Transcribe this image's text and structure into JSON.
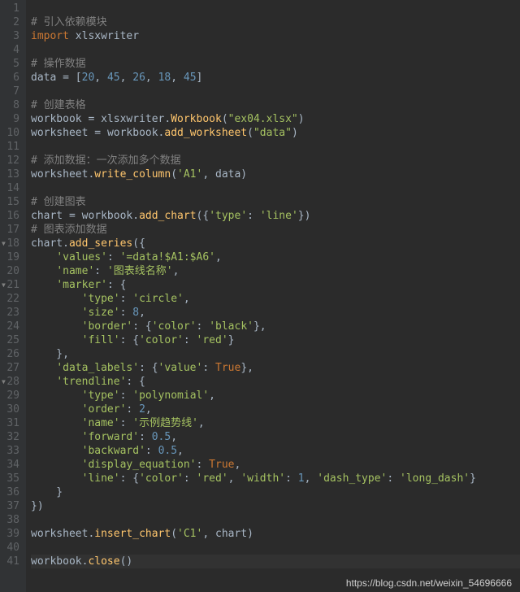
{
  "watermark": "https://blog.csdn.net/weixin_54696666",
  "gutter": {
    "start": 1,
    "end": 41,
    "fold_lines": [
      18,
      21,
      28
    ]
  },
  "code": {
    "1": [],
    "2": [
      {
        "t": "# 引入依赖模块",
        "c": "comment"
      }
    ],
    "3": [
      {
        "t": "import ",
        "c": "keyword"
      },
      {
        "t": "xlsxwriter",
        "c": "module"
      }
    ],
    "4": [],
    "5": [
      {
        "t": "# 操作数据",
        "c": "comment"
      }
    ],
    "6": [
      {
        "t": "data ",
        "c": "op"
      },
      {
        "t": "= ",
        "c": "op"
      },
      {
        "t": "[",
        "c": "paren"
      },
      {
        "t": "20",
        "c": "number"
      },
      {
        "t": ", ",
        "c": "op"
      },
      {
        "t": "45",
        "c": "number"
      },
      {
        "t": ", ",
        "c": "op"
      },
      {
        "t": "26",
        "c": "number"
      },
      {
        "t": ", ",
        "c": "op"
      },
      {
        "t": "18",
        "c": "number"
      },
      {
        "t": ", ",
        "c": "op"
      },
      {
        "t": "45",
        "c": "number"
      },
      {
        "t": "]",
        "c": "paren"
      }
    ],
    "7": [],
    "8": [
      {
        "t": "# 创建表格",
        "c": "comment"
      }
    ],
    "9": [
      {
        "t": "workbook ",
        "c": "op"
      },
      {
        "t": "= ",
        "c": "op"
      },
      {
        "t": "xlsxwriter.",
        "c": "module"
      },
      {
        "t": "Workbook",
        "c": "func"
      },
      {
        "t": "(",
        "c": "paren"
      },
      {
        "t": "\"ex04.xlsx\"",
        "c": "string"
      },
      {
        "t": ")",
        "c": "paren"
      }
    ],
    "10": [
      {
        "t": "worksheet ",
        "c": "op"
      },
      {
        "t": "= ",
        "c": "op"
      },
      {
        "t": "workbook.",
        "c": "module"
      },
      {
        "t": "add_worksheet",
        "c": "func"
      },
      {
        "t": "(",
        "c": "paren"
      },
      {
        "t": "\"data\"",
        "c": "string"
      },
      {
        "t": ")",
        "c": "paren"
      }
    ],
    "11": [],
    "12": [
      {
        "t": "# 添加数据：一次添加多个数据",
        "c": "comment"
      }
    ],
    "13": [
      {
        "t": "worksheet.",
        "c": "module"
      },
      {
        "t": "write_column",
        "c": "func"
      },
      {
        "t": "(",
        "c": "paren"
      },
      {
        "t": "'A1'",
        "c": "string"
      },
      {
        "t": ", data)",
        "c": "paren"
      }
    ],
    "14": [],
    "15": [
      {
        "t": "# 创建图表",
        "c": "comment"
      }
    ],
    "16": [
      {
        "t": "chart ",
        "c": "op"
      },
      {
        "t": "= ",
        "c": "op"
      },
      {
        "t": "workbook.",
        "c": "module"
      },
      {
        "t": "add_chart",
        "c": "func"
      },
      {
        "t": "({",
        "c": "paren"
      },
      {
        "t": "'type'",
        "c": "string"
      },
      {
        "t": ": ",
        "c": "op"
      },
      {
        "t": "'line'",
        "c": "string"
      },
      {
        "t": "})",
        "c": "paren"
      }
    ],
    "17": [
      {
        "t": "# 图表添加数据",
        "c": "comment"
      }
    ],
    "18": [
      {
        "t": "chart.",
        "c": "module"
      },
      {
        "t": "add_series",
        "c": "func"
      },
      {
        "t": "({",
        "c": "paren"
      }
    ],
    "19": [
      {
        "t": "    ",
        "c": "op"
      },
      {
        "t": "'values'",
        "c": "string"
      },
      {
        "t": ": ",
        "c": "op"
      },
      {
        "t": "'=data!$A1:$A6'",
        "c": "string"
      },
      {
        "t": ",",
        "c": "op"
      }
    ],
    "20": [
      {
        "t": "    ",
        "c": "op"
      },
      {
        "t": "'name'",
        "c": "string"
      },
      {
        "t": ": ",
        "c": "op"
      },
      {
        "t": "'图表线名称'",
        "c": "string"
      },
      {
        "t": ",",
        "c": "op"
      }
    ],
    "21": [
      {
        "t": "    ",
        "c": "op"
      },
      {
        "t": "'marker'",
        "c": "string"
      },
      {
        "t": ": {",
        "c": "paren"
      }
    ],
    "22": [
      {
        "t": "        ",
        "c": "op"
      },
      {
        "t": "'type'",
        "c": "string"
      },
      {
        "t": ": ",
        "c": "op"
      },
      {
        "t": "'circle'",
        "c": "string"
      },
      {
        "t": ",",
        "c": "op"
      }
    ],
    "23": [
      {
        "t": "        ",
        "c": "op"
      },
      {
        "t": "'size'",
        "c": "string"
      },
      {
        "t": ": ",
        "c": "op"
      },
      {
        "t": "8",
        "c": "number"
      },
      {
        "t": ",",
        "c": "op"
      }
    ],
    "24": [
      {
        "t": "        ",
        "c": "op"
      },
      {
        "t": "'border'",
        "c": "string"
      },
      {
        "t": ": {",
        "c": "paren"
      },
      {
        "t": "'color'",
        "c": "string"
      },
      {
        "t": ": ",
        "c": "op"
      },
      {
        "t": "'black'",
        "c": "string"
      },
      {
        "t": "},",
        "c": "paren"
      }
    ],
    "25": [
      {
        "t": "        ",
        "c": "op"
      },
      {
        "t": "'fill'",
        "c": "string"
      },
      {
        "t": ": {",
        "c": "paren"
      },
      {
        "t": "'color'",
        "c": "string"
      },
      {
        "t": ": ",
        "c": "op"
      },
      {
        "t": "'red'",
        "c": "string"
      },
      {
        "t": "}",
        "c": "paren"
      }
    ],
    "26": [
      {
        "t": "    },",
        "c": "paren"
      }
    ],
    "27": [
      {
        "t": "    ",
        "c": "op"
      },
      {
        "t": "'data_labels'",
        "c": "string"
      },
      {
        "t": ": {",
        "c": "paren"
      },
      {
        "t": "'value'",
        "c": "string"
      },
      {
        "t": ": ",
        "c": "op"
      },
      {
        "t": "True",
        "c": "bool"
      },
      {
        "t": "},",
        "c": "paren"
      }
    ],
    "28": [
      {
        "t": "    ",
        "c": "op"
      },
      {
        "t": "'trendline'",
        "c": "string"
      },
      {
        "t": ": {",
        "c": "paren"
      }
    ],
    "29": [
      {
        "t": "        ",
        "c": "op"
      },
      {
        "t": "'type'",
        "c": "string"
      },
      {
        "t": ": ",
        "c": "op"
      },
      {
        "t": "'polynomial'",
        "c": "string"
      },
      {
        "t": ",",
        "c": "op"
      }
    ],
    "30": [
      {
        "t": "        ",
        "c": "op"
      },
      {
        "t": "'order'",
        "c": "string"
      },
      {
        "t": ": ",
        "c": "op"
      },
      {
        "t": "2",
        "c": "number"
      },
      {
        "t": ",",
        "c": "op"
      }
    ],
    "31": [
      {
        "t": "        ",
        "c": "op"
      },
      {
        "t": "'name'",
        "c": "string"
      },
      {
        "t": ": ",
        "c": "op"
      },
      {
        "t": "'示例趋势线'",
        "c": "string"
      },
      {
        "t": ",",
        "c": "op"
      }
    ],
    "32": [
      {
        "t": "        ",
        "c": "op"
      },
      {
        "t": "'forward'",
        "c": "string"
      },
      {
        "t": ": ",
        "c": "op"
      },
      {
        "t": "0.5",
        "c": "number"
      },
      {
        "t": ",",
        "c": "op"
      }
    ],
    "33": [
      {
        "t": "        ",
        "c": "op"
      },
      {
        "t": "'backward'",
        "c": "string"
      },
      {
        "t": ": ",
        "c": "op"
      },
      {
        "t": "0.5",
        "c": "number"
      },
      {
        "t": ",",
        "c": "op"
      }
    ],
    "34": [
      {
        "t": "        ",
        "c": "op"
      },
      {
        "t": "'display_equation'",
        "c": "string"
      },
      {
        "t": ": ",
        "c": "op"
      },
      {
        "t": "True",
        "c": "bool"
      },
      {
        "t": ",",
        "c": "op"
      }
    ],
    "35": [
      {
        "t": "        ",
        "c": "op"
      },
      {
        "t": "'line'",
        "c": "string"
      },
      {
        "t": ": {",
        "c": "paren"
      },
      {
        "t": "'color'",
        "c": "string"
      },
      {
        "t": ": ",
        "c": "op"
      },
      {
        "t": "'red'",
        "c": "string"
      },
      {
        "t": ", ",
        "c": "op"
      },
      {
        "t": "'width'",
        "c": "string"
      },
      {
        "t": ": ",
        "c": "op"
      },
      {
        "t": "1",
        "c": "number"
      },
      {
        "t": ", ",
        "c": "op"
      },
      {
        "t": "'dash_type'",
        "c": "string"
      },
      {
        "t": ": ",
        "c": "op"
      },
      {
        "t": "'long_dash'",
        "c": "string"
      },
      {
        "t": "}",
        "c": "paren"
      }
    ],
    "36": [
      {
        "t": "    }",
        "c": "paren"
      }
    ],
    "37": [
      {
        "t": "})",
        "c": "paren"
      }
    ],
    "38": [],
    "39": [
      {
        "t": "worksheet.",
        "c": "module"
      },
      {
        "t": "insert_chart",
        "c": "func"
      },
      {
        "t": "(",
        "c": "paren"
      },
      {
        "t": "'C1'",
        "c": "string"
      },
      {
        "t": ", chart)",
        "c": "paren"
      }
    ],
    "40": [],
    "41": [
      {
        "t": "workbook.",
        "c": "module"
      },
      {
        "t": "close",
        "c": "func"
      },
      {
        "t": "()",
        "c": "paren"
      }
    ]
  },
  "highlighted_line": 41
}
